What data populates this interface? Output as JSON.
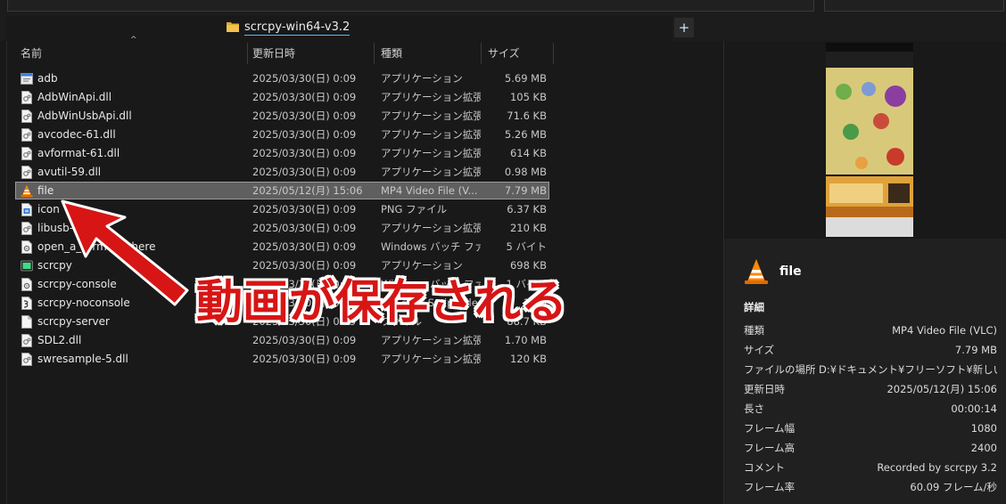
{
  "tab": {
    "label": "scrcpy-win64-v3.2",
    "add_label": "+"
  },
  "columns": {
    "name": "名前",
    "date": "更新日時",
    "type": "種類",
    "size": "サイズ"
  },
  "files": [
    {
      "name": "adb",
      "date": "2025/03/30(日) 0:09",
      "type": "アプリケーション",
      "size": "5.69 MB",
      "icon": "exe-icon"
    },
    {
      "name": "AdbWinApi.dll",
      "date": "2025/03/30(日) 0:09",
      "type": "アプリケーション拡張",
      "size": "105 KB",
      "icon": "dll-icon"
    },
    {
      "name": "AdbWinUsbApi.dll",
      "date": "2025/03/30(日) 0:09",
      "type": "アプリケーション拡張",
      "size": "71.6 KB",
      "icon": "dll-icon"
    },
    {
      "name": "avcodec-61.dll",
      "date": "2025/03/30(日) 0:09",
      "type": "アプリケーション拡張",
      "size": "5.26 MB",
      "icon": "dll-icon"
    },
    {
      "name": "avformat-61.dll",
      "date": "2025/03/30(日) 0:09",
      "type": "アプリケーション拡張",
      "size": "614 KB",
      "icon": "dll-icon"
    },
    {
      "name": "avutil-59.dll",
      "date": "2025/03/30(日) 0:09",
      "type": "アプリケーション拡張",
      "size": "0.98 MB",
      "icon": "dll-icon"
    },
    {
      "name": "file",
      "date": "2025/05/12(月) 15:06",
      "type": "MP4 Video File (V...",
      "size": "7.79 MB",
      "icon": "vlc-icon",
      "selected": true
    },
    {
      "name": "icon",
      "date": "2025/03/30(日) 0:09",
      "type": "PNG ファイル",
      "size": "6.37 KB",
      "icon": "png-icon"
    },
    {
      "name": "libusb-1.0.dll",
      "date": "2025/03/30(日) 0:09",
      "type": "アプリケーション拡張",
      "size": "210 KB",
      "icon": "dll-icon"
    },
    {
      "name": "open_a_terminal_here",
      "date": "2025/03/30(日) 0:09",
      "type": "Windows バッチ ファ...",
      "size": "5 バイト",
      "icon": "bat-icon"
    },
    {
      "name": "scrcpy",
      "date": "2025/03/30(日) 0:09",
      "type": "アプリケーション",
      "size": "698 KB",
      "icon": "scrcpy-icon"
    },
    {
      "name": "scrcpy-console",
      "date": "2025/03/30(日) 0:09",
      "type": "Windows バッチ ファ...",
      "size": "1 バイト",
      "icon": "bat-icon"
    },
    {
      "name": "scrcpy-noconsole",
      "date": "2025/03/30(日) 0:09",
      "type": "VBScript Script File",
      "size": "1 KB",
      "icon": "vbs-icon"
    },
    {
      "name": "scrcpy-server",
      "date": "2025/03/30(日) 0:09",
      "type": "ファイル",
      "size": "88.7 KB",
      "icon": "generic-file-icon"
    },
    {
      "name": "SDL2.dll",
      "date": "2025/03/30(日) 0:09",
      "type": "アプリケーション拡張",
      "size": "1.70 MB",
      "icon": "dll-icon"
    },
    {
      "name": "swresample-5.dll",
      "date": "2025/03/30(日) 0:09",
      "type": "アプリケーション拡張",
      "size": "120 KB",
      "icon": "dll-icon"
    }
  ],
  "annotation": {
    "text": "動画が保存される"
  },
  "details": {
    "title": "file",
    "section": "詳細",
    "rows": [
      {
        "k": "種類",
        "v": "MP4 Video File (VLC)"
      },
      {
        "k": "サイズ",
        "v": "7.79 MB"
      },
      {
        "k": "ファイルの場所",
        "v": "D:¥ドキュメント¥フリーソフト¥新しいフ..."
      },
      {
        "k": "更新日時",
        "v": "2025/05/12(月) 15:06"
      },
      {
        "k": "長さ",
        "v": "00:00:14"
      },
      {
        "k": "フレーム幅",
        "v": "1080"
      },
      {
        "k": "フレーム高",
        "v": "2400"
      },
      {
        "k": "コメント",
        "v": "Recorded by scrcpy 3.2"
      },
      {
        "k": "フレーム率",
        "v": "60.09 フレーム/秒"
      }
    ]
  },
  "colors": {
    "selection": "#5f5f5f",
    "accent": "#4cc2ff",
    "annotation_red": "#d71515"
  }
}
